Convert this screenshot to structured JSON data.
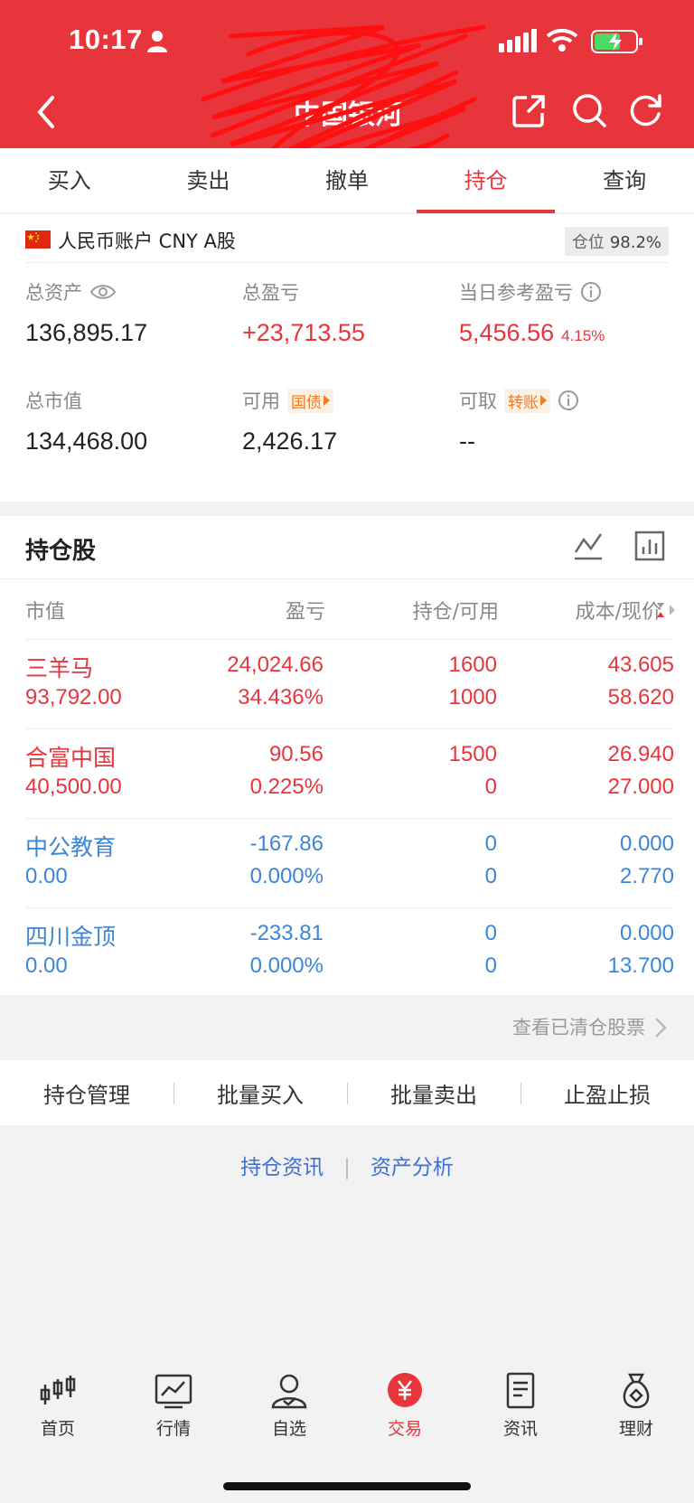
{
  "status_bar": {
    "time": "10:17"
  },
  "header": {
    "title": "中国银河"
  },
  "tabs": [
    "买入",
    "卖出",
    "撤单",
    "持仓",
    "查询"
  ],
  "account": {
    "name": "人民币账户 CNY A股",
    "position_label": "仓位",
    "position_value": "98.2%"
  },
  "metrics": {
    "total_assets_label": "总资产",
    "total_assets": "136,895.17",
    "total_pl_label": "总盈亏",
    "total_pl": "+23,713.55",
    "daily_pl_label": "当日参考盈亏",
    "daily_pl": "5,456.56",
    "daily_pl_pct": "4.15%",
    "market_value_label": "总市值",
    "market_value": "134,468.00",
    "available_label": "可用",
    "available_tag": "国债",
    "available": "2,426.17",
    "withdrawable_label": "可取",
    "withdrawable_tag": "转账",
    "withdrawable": "--"
  },
  "holdings": {
    "title": "持仓股",
    "columns": [
      "市值",
      "盈亏",
      "持仓/可用",
      "成本/现价"
    ],
    "rows": [
      {
        "name": "三羊马",
        "market_value": "93,792.00",
        "pl": "24,024.66",
        "pl_pct": "34.436%",
        "holding": "1600",
        "available": "1000",
        "cost": "43.605",
        "price": "58.620"
      },
      {
        "name": "合富中国",
        "market_value": "40,500.00",
        "pl": "90.56",
        "pl_pct": "0.225%",
        "holding": "1500",
        "available": "0",
        "cost": "26.940",
        "price": "27.000"
      },
      {
        "name": "中公教育",
        "market_value": "0.00",
        "pl": "-167.86",
        "pl_pct": "0.000%",
        "holding": "0",
        "available": "0",
        "cost": "0.000",
        "price": "2.770"
      },
      {
        "name": "四川金顶",
        "market_value": "0.00",
        "pl": "-233.81",
        "pl_pct": "0.000%",
        "holding": "0",
        "available": "0",
        "cost": "0.000",
        "price": "13.700"
      }
    ]
  },
  "cleared_link": "查看已清仓股票",
  "actions": [
    "持仓管理",
    "批量买入",
    "批量卖出",
    "止盈止损"
  ],
  "links": [
    "持仓资讯",
    "资产分析"
  ],
  "bottom_nav": [
    "首页",
    "行情",
    "自选",
    "交易",
    "资讯",
    "理财"
  ],
  "colors": {
    "brand_red": "#e8353c",
    "loss_blue": "#3d86d6",
    "tag_orange": "#f07a22"
  }
}
